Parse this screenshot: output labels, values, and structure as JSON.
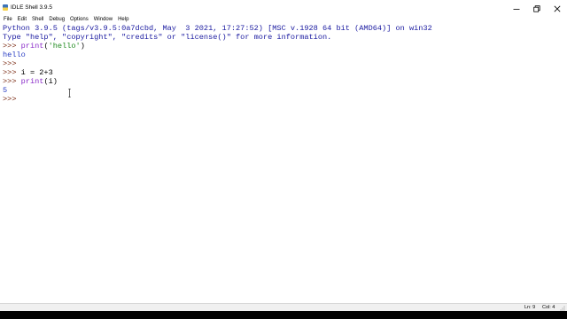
{
  "window": {
    "title": "IDLE Shell 3.9.5",
    "controls": [
      "minimize-icon",
      "maximize-icon",
      "close-icon"
    ]
  },
  "menu": {
    "items": [
      "File",
      "Edit",
      "Shell",
      "Debug",
      "Options",
      "Window",
      "Help"
    ]
  },
  "shell": {
    "banner1": "Python 3.9.5 (tags/v3.9.5:0a7dcbd, May  3 2021, 17:27:52) [MSC v.1928 64 bit (AMD64)] on win32",
    "banner2": "Type \"help\", \"copyright\", \"credits\" or \"license()\" for more information.",
    "prompt": ">>> ",
    "cmd1": {
      "keyword": "print",
      "open": "(",
      "string": "'hello'",
      "close": ")"
    },
    "output1": "hello",
    "cmd2": "i = 2+3",
    "cmd3": {
      "keyword": "print",
      "rest": "(i)"
    },
    "output3": "5"
  },
  "status": {
    "line": "Ln: 9",
    "col": "Col: 4"
  },
  "colors": {
    "prompt": "#7a2a12",
    "keyword": "#8a2bc9",
    "string": "#1f8a1f",
    "output": "#1a1aa0"
  }
}
